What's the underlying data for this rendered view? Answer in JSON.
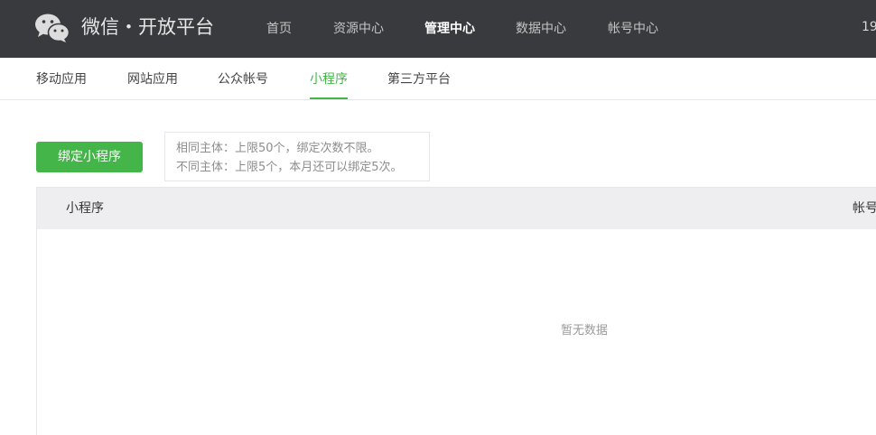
{
  "header": {
    "brand": "微信・开放平台",
    "logo_icon": "wechat-logo-icon",
    "nav": [
      {
        "label": "首页",
        "active": false
      },
      {
        "label": "资源中心",
        "active": false
      },
      {
        "label": "管理中心",
        "active": true
      },
      {
        "label": "数据中心",
        "active": false
      },
      {
        "label": "帐号中心",
        "active": false
      }
    ],
    "account_text": "19"
  },
  "subnav": {
    "tabs": [
      {
        "label": "移动应用",
        "active": false
      },
      {
        "label": "网站应用",
        "active": false
      },
      {
        "label": "公众帐号",
        "active": false
      },
      {
        "label": "小程序",
        "active": true
      },
      {
        "label": "第三方平台",
        "active": false
      }
    ]
  },
  "toolbar": {
    "bind_button_label": "绑定小程序",
    "tips": [
      "相同主体：上限50个，绑定次数不限。",
      "不同主体：上限5个，本月还可以绑定5次。"
    ]
  },
  "table": {
    "columns": [
      "小程序",
      "帐号"
    ],
    "empty_text": "暂无数据"
  },
  "colors": {
    "topbar": "#393a3e",
    "accent": "#44b549",
    "table_header": "#eeeef1"
  }
}
